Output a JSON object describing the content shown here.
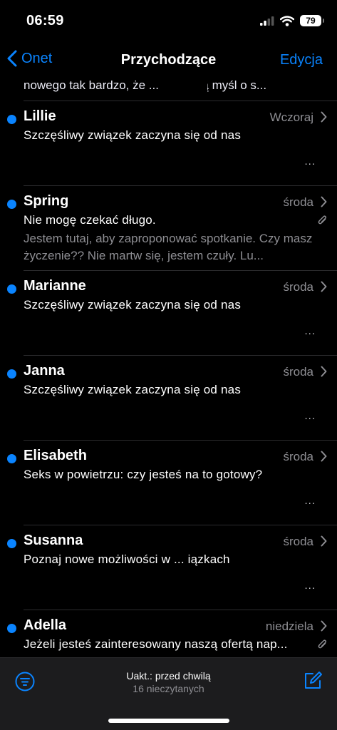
{
  "status_bar": {
    "time": "06:59",
    "battery": "79"
  },
  "nav": {
    "back_label": "Onet",
    "title": "Przychodzące",
    "edit_label": "Edycja"
  },
  "previous_snippet": "nowego tak bardzo, że ... na samą myśl o s...",
  "emails": [
    {
      "sender": "Lillie",
      "date": "Wczoraj",
      "subject": "Szczęśliwy związek zaczyna się od nas",
      "preview": "",
      "more": "...",
      "attachment": false
    },
    {
      "sender": "Spring",
      "date": "środa",
      "subject": "Nie mogę czekać długo.",
      "preview": "Jestem tutaj, aby zaproponować spotkanie. Czy masz życzenie?? Nie martw się, jestem czuły. Lu...",
      "more": "",
      "attachment": true
    },
    {
      "sender": "Marianne",
      "date": "środa",
      "subject": "Szczęśliwy związek zaczyna się od nas",
      "preview": "",
      "more": "...",
      "attachment": false
    },
    {
      "sender": "Janna",
      "date": "środa",
      "subject": "Szczęśliwy związek zaczyna się od nas",
      "preview": "",
      "more": "...",
      "attachment": false
    },
    {
      "sender": "Elisabeth",
      "date": "środa",
      "subject": "Seks w powietrzu: czy jesteś na to gotowy?",
      "preview": "",
      "more": "...",
      "attachment": false
    },
    {
      "sender": "Susanna",
      "date": "środa",
      "subject": "Poznaj nowe możliwości w ... iązkach",
      "preview": "",
      "more": "...",
      "attachment": false
    },
    {
      "sender": "Adella",
      "date": "niedziela",
      "subject": "Jeżeli jesteś zainteresowany naszą ofertą nap...",
      "preview": "",
      "more": "",
      "attachment": true
    }
  ],
  "toolbar": {
    "updated": "Uakt.: przed chwilą",
    "unread": "16 nieczytanych"
  },
  "colors": {
    "accent": "#0a84ff",
    "secondary_text": "#8e8e93",
    "background": "#000000",
    "toolbar": "#1c1c1e"
  },
  "icons": [
    "chevron-left-icon",
    "chevron-right-icon",
    "paperclip-icon",
    "filter-icon",
    "compose-icon",
    "signal-icon",
    "wifi-icon",
    "battery-icon"
  ]
}
